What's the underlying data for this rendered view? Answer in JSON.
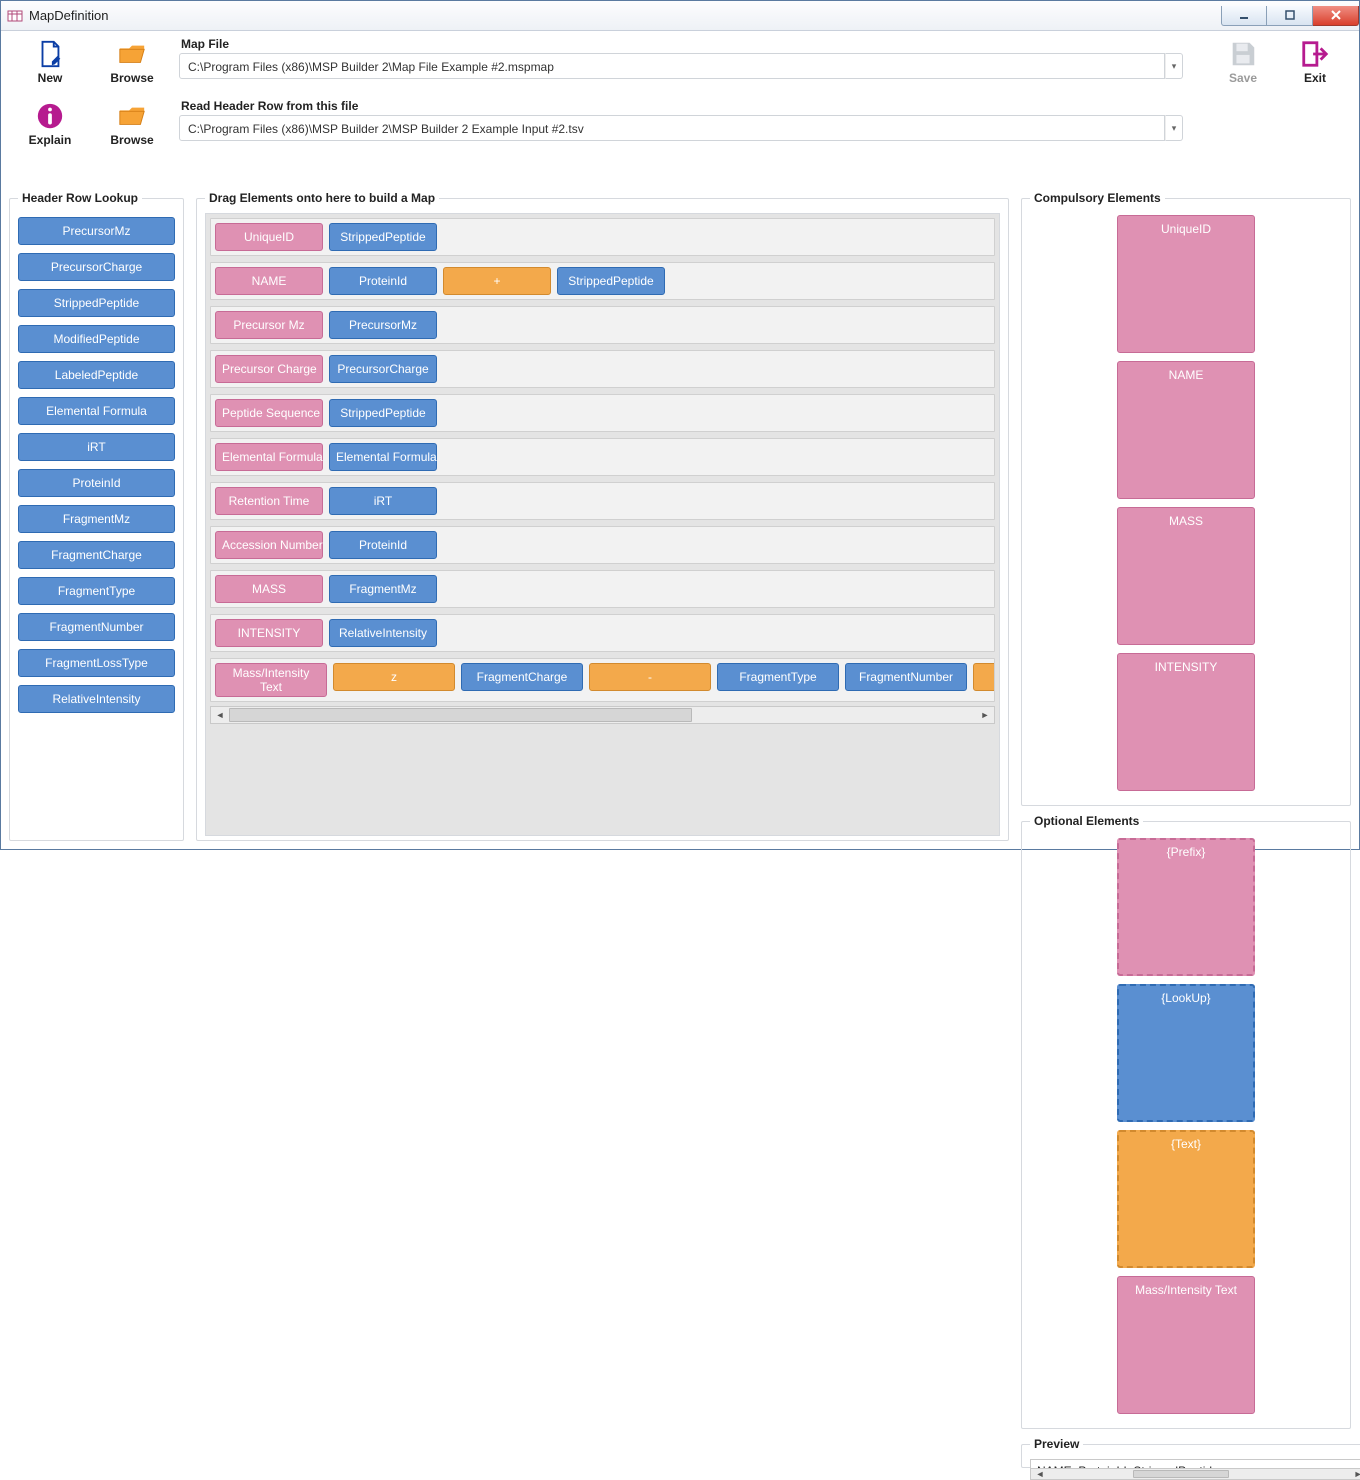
{
  "window": {
    "title": "MapDefinition"
  },
  "toolbar": {
    "new": "New",
    "browse1": "Browse",
    "explain": "Explain",
    "browse2": "Browse",
    "save": "Save",
    "exit": "Exit"
  },
  "paths": {
    "mapfile_label": "Map File",
    "mapfile_value": "C:\\Program Files (x86)\\MSP Builder 2\\Map File Example #2.mspmap",
    "header_label": "Read Header Row from this file",
    "header_value": "C:\\Program Files (x86)\\MSP Builder 2\\MSP Builder 2 Example Input #2.tsv"
  },
  "left": {
    "legend": "Header Row Lookup",
    "items": [
      "PrecursorMz",
      "PrecursorCharge",
      "StrippedPeptide",
      "ModifiedPeptide",
      "LabeledPeptide",
      "Elemental Formula",
      "iRT",
      "ProteinId",
      "FragmentMz",
      "FragmentCharge",
      "FragmentType",
      "FragmentNumber",
      "FragmentLossType",
      "RelativeIntensity"
    ]
  },
  "mid": {
    "legend": "Drag Elements onto here to build a Map",
    "rows": [
      [
        {
          "t": "pink",
          "v": "UniqueID"
        },
        {
          "t": "blue",
          "v": "StrippedPeptide"
        }
      ],
      [
        {
          "t": "pink",
          "v": "NAME"
        },
        {
          "t": "blue",
          "v": "ProteinId"
        },
        {
          "t": "orange",
          "v": "+"
        },
        {
          "t": "blue",
          "v": "StrippedPeptide"
        }
      ],
      [
        {
          "t": "pink",
          "v": "Precursor Mz"
        },
        {
          "t": "blue",
          "v": "PrecursorMz"
        }
      ],
      [
        {
          "t": "pink",
          "v": "Precursor Charge"
        },
        {
          "t": "blue",
          "v": "PrecursorCharge"
        }
      ],
      [
        {
          "t": "pink",
          "v": "Peptide Sequence"
        },
        {
          "t": "blue",
          "v": "StrippedPeptide"
        }
      ],
      [
        {
          "t": "pink",
          "v": "Elemental Formula"
        },
        {
          "t": "blue",
          "v": "Elemental Formula"
        }
      ],
      [
        {
          "t": "pink",
          "v": "Retention Time"
        },
        {
          "t": "blue",
          "v": "iRT"
        }
      ],
      [
        {
          "t": "pink",
          "v": "Accession Number"
        },
        {
          "t": "blue",
          "v": "ProteinId"
        }
      ],
      [
        {
          "t": "pink",
          "v": "MASS"
        },
        {
          "t": "blue",
          "v": "FragmentMz"
        }
      ],
      [
        {
          "t": "pink",
          "v": "INTENSITY"
        },
        {
          "t": "blue",
          "v": "RelativeIntensity"
        }
      ]
    ],
    "lastRow": {
      "label": "Mass/Intensity Text",
      "cells": [
        {
          "t": "orange",
          "v": "z"
        },
        {
          "t": "blue",
          "v": "FragmentCharge"
        },
        {
          "t": "orange",
          "v": "-"
        },
        {
          "t": "blue",
          "v": "FragmentType"
        },
        {
          "t": "blue",
          "v": "FragmentNumber"
        },
        {
          "t": "orange",
          "v": "&"
        }
      ]
    }
  },
  "right": {
    "compulsory_legend": "Compulsory Elements",
    "compulsory": [
      "UniqueID",
      "NAME",
      "MASS",
      "INTENSITY"
    ],
    "optional_legend": "Optional Elements",
    "optional": [
      {
        "t": "pink",
        "v": "{Prefix}",
        "dashed": true
      },
      {
        "t": "blue",
        "v": "{LookUp}",
        "dashed": true
      },
      {
        "t": "orange",
        "v": "{Text}",
        "dashed": true
      },
      {
        "t": "pink",
        "v": "Mass/Intensity Text",
        "dashed": false
      }
    ],
    "preview_legend": "Preview",
    "preview_text": "NAME: ProteinId+StrippedPeptide\nPRECURSOR MZ: PrecursorMz\nPRECURSOR CHARGE: PrecursorCharge\nPEPTIDE SEQUENCE: StrippedPeptide\nELEMENTAL FORMULA: Elemental Formula\nRETENTION TIME: iRT\nACCESSION NUMBER: ProteinId\n\nNum Peaks: {From your data}\n{Mass}           {Intensity}               {Comment-Optional}\nFragmentMz    RelativeIntensity       zFragmentCharge - Frag"
  }
}
